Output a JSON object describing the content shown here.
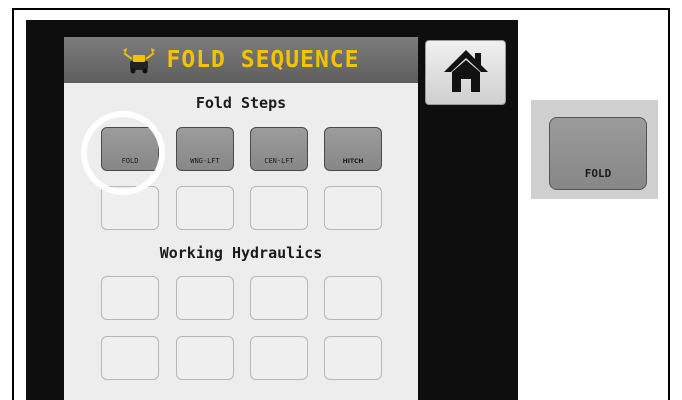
{
  "header": {
    "title": "FOLD SEQUENCE",
    "icon": "hydraulic-fold-icon"
  },
  "sections": {
    "fold_steps": "Fold Steps",
    "working_hydraulics": "Working Hydraulics"
  },
  "fold_steps": [
    "FOLD",
    "WNG-LFT",
    "CEN-LFT",
    "HITCH"
  ],
  "home": {
    "icon": "home-icon"
  },
  "zoom": {
    "label": "FOLD"
  },
  "colors": {
    "title": "#f2c300",
    "highlight": "#ffffff",
    "screen": "#0e0e0e"
  }
}
